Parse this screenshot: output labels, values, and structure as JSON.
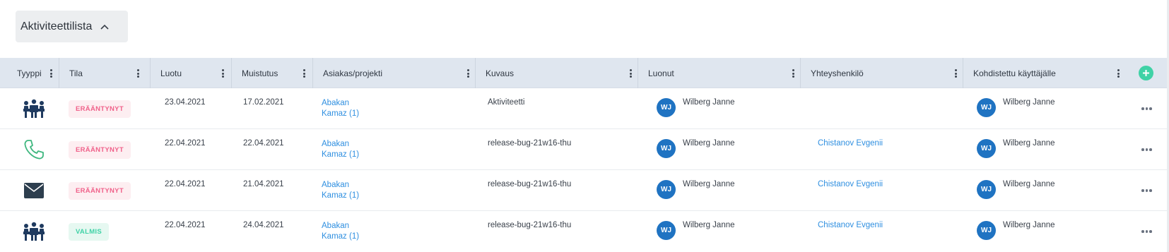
{
  "panel": {
    "title": "Aktiviteettilista"
  },
  "table": {
    "columns": [
      "Tyyppi",
      "Tila",
      "Luotu",
      "Muistutus",
      "Asiakas/projekti",
      "Kuvaus",
      "Luonut",
      "Yhteyshenkilö",
      "Kohdistettu käyttäjälle"
    ],
    "rows": [
      {
        "type_icon": "meeting-icon",
        "status": "ERÄÄNTYNYT",
        "status_kind": "overdue",
        "created": "23.04.2021",
        "reminder": "17.02.2021",
        "customer": "Abakan",
        "project": "Kamaz (1)",
        "description": "Aktiviteetti",
        "creator_initials": "WJ",
        "creator": "Wilberg Janne",
        "contact": "",
        "assignee_initials": "WJ",
        "assignee": "Wilberg Janne"
      },
      {
        "type_icon": "phone-icon",
        "status": "ERÄÄNTYNYT",
        "status_kind": "overdue",
        "created": "22.04.2021",
        "reminder": "22.04.2021",
        "customer": "Abakan",
        "project": "Kamaz (1)",
        "description": "release-bug-21w16-thu",
        "creator_initials": "WJ",
        "creator": "Wilberg Janne",
        "contact": "Chistanov Evgenii",
        "assignee_initials": "WJ",
        "assignee": "Wilberg Janne"
      },
      {
        "type_icon": "envelope-icon",
        "status": "ERÄÄNTYNYT",
        "status_kind": "overdue",
        "created": "22.04.2021",
        "reminder": "21.04.2021",
        "customer": "Abakan",
        "project": "Kamaz (1)",
        "description": "release-bug-21w16-thu",
        "creator_initials": "WJ",
        "creator": "Wilberg Janne",
        "contact": "Chistanov Evgenii",
        "assignee_initials": "WJ",
        "assignee": "Wilberg Janne"
      },
      {
        "type_icon": "meeting-icon",
        "status": "VALMIS",
        "status_kind": "done",
        "created": "22.04.2021",
        "reminder": "24.04.2021",
        "customer": "Abakan",
        "project": "Kamaz (1)",
        "description": "release-bug-21w16-thu",
        "creator_initials": "WJ",
        "creator": "Wilberg Janne",
        "contact": "Chistanov Evgenii",
        "assignee_initials": "WJ",
        "assignee": "Wilberg Janne"
      }
    ]
  },
  "colors": {
    "header_bg": "#dfe6ef",
    "overdue_text": "#f0618a",
    "done_text": "#3fd2a6",
    "link": "#2f8fe0",
    "avatar": "#1f73c2",
    "add_button": "#3fd2a6"
  }
}
